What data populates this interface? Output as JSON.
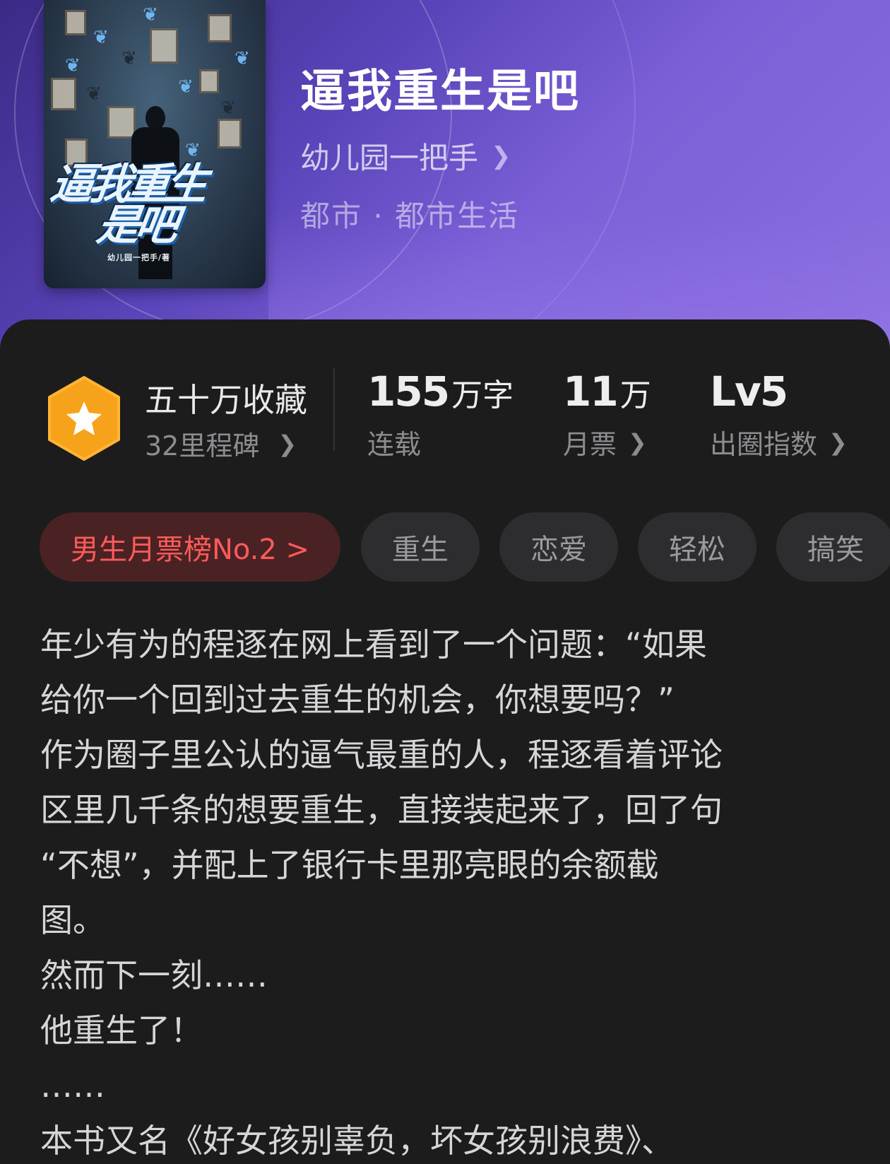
{
  "book": {
    "title": "逼我重生是吧",
    "author": "幼儿园一把手",
    "genre": "都市 · 都市生活",
    "cover": {
      "title_line1": "逼我重生",
      "title_line2": "是吧",
      "author_credit": "幼儿园一把手/著"
    }
  },
  "stats": {
    "favorites": {
      "title": "五十万收藏",
      "sub": "32里程碑"
    },
    "words": {
      "value": "155",
      "unit": "万字",
      "label": "连载"
    },
    "monthly_tickets": {
      "value": "11",
      "unit": "万",
      "label": "月票"
    },
    "level": {
      "value": "Lv5",
      "label": "出圈指数"
    }
  },
  "tags": {
    "rank": "男生月票榜No.2 >",
    "items": [
      "重生",
      "恋爱",
      "轻松",
      "搞笑"
    ]
  },
  "description": [
    "年少有为的程逐在网上看到了一个问题：“如果",
    "给你一个回到过去重生的机会，你想要吗？”",
    "作为圈子里公认的逼气最重的人，程逐看着评论",
    "区里几千条的想要重生，直接装起来了，回了句",
    "“不想”，并配上了银行卡里那亮眼的余额截",
    "图。",
    "然而下一刻……",
    "他重生了！",
    "……",
    "本书又名《好女孩别辜负，坏女孩别浪费》、"
  ],
  "icons": {
    "badge": "star-badge-icon",
    "chevron": "chevron-right-icon"
  },
  "colors": {
    "hero_gradient_start": "#3c2a86",
    "hero_gradient_end": "#8a6fe0",
    "panel_bg": "#1c1c1d",
    "badge_orange": "#f7a21b",
    "rank_text": "#ff5a5a",
    "rank_bg": "#4a2224"
  }
}
